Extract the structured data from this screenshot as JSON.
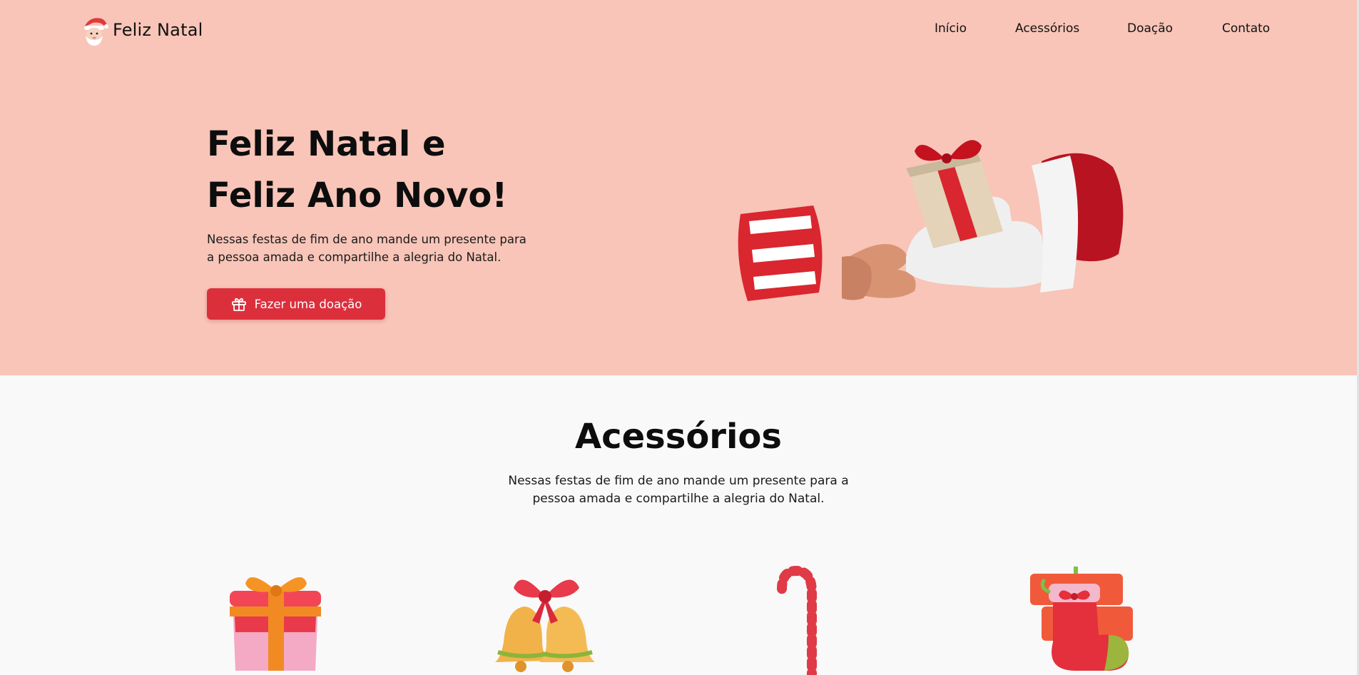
{
  "brand": {
    "name": "Feliz Natal",
    "logo_icon": "santa-icon"
  },
  "nav": {
    "items": [
      "Início",
      "Acessórios",
      "Doação",
      "Contato"
    ]
  },
  "hero": {
    "title_line1": "Feliz Natal e",
    "title_line2": "Feliz Ano Novo!",
    "description": "Nessas festas de fim de ano mande um presente para a pessoa amada e compartilhe a alegria do Natal.",
    "cta_label": "Fazer uma doação",
    "cta_icon": "gift-icon",
    "illustration": "hands-giving-gift-illustration"
  },
  "accessories": {
    "title": "Acessórios",
    "description": "Nessas festas de fim de ano mande um presente para a pessoa amada e compartilhe a alegria do Natal.",
    "items": [
      "gift-box",
      "christmas-bells",
      "candy-cane",
      "stocking-with-gifts"
    ]
  },
  "colors": {
    "hero_bg": "#f8c5b8",
    "accent": "#dc2f3c",
    "page_bg": "#f9f9f9",
    "text": "#111111"
  }
}
